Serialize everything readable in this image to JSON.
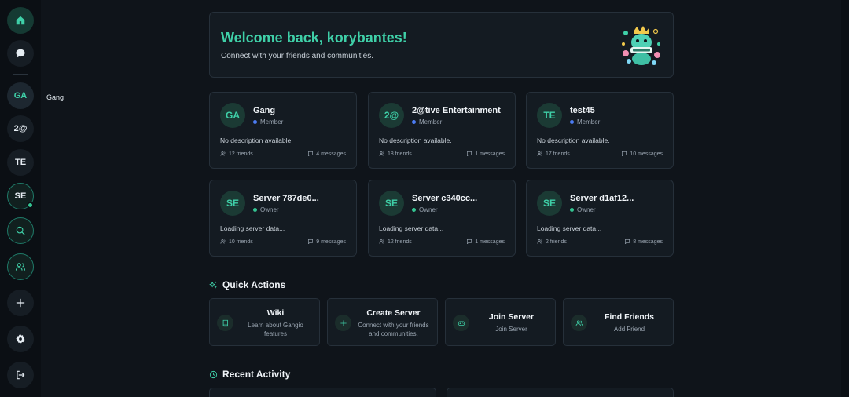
{
  "sidebar": {
    "servers": [
      {
        "initials": "GA",
        "tooltip": "Gang"
      },
      {
        "initials": "2@"
      },
      {
        "initials": "TE"
      },
      {
        "initials": "SE"
      }
    ],
    "tooltip": "Gang"
  },
  "welcome": {
    "title": "Welcome back, korybantes!",
    "subtitle": "Connect with your friends and communities."
  },
  "servers": [
    {
      "initials": "GA",
      "name": "Gang",
      "role": "Member",
      "role_color": "#4c7cf3",
      "description": "No description available.",
      "friends": "12 friends",
      "messages": "4 messages"
    },
    {
      "initials": "2@",
      "name": "2@tive Entertainment",
      "role": "Member",
      "role_color": "#4c7cf3",
      "description": "No description available.",
      "friends": "18 friends",
      "messages": "1 messages"
    },
    {
      "initials": "TE",
      "name": "test45",
      "role": "Member",
      "role_color": "#4c7cf3",
      "description": "No description available.",
      "friends": "17 friends",
      "messages": "10 messages"
    },
    {
      "initials": "SE",
      "name": "Server 787de0...",
      "role": "Owner",
      "role_color": "#34c391",
      "description": "Loading server data...",
      "friends": "10 friends",
      "messages": "9 messages"
    },
    {
      "initials": "SE",
      "name": "Server c340cc...",
      "role": "Owner",
      "role_color": "#34c391",
      "description": "Loading server data...",
      "friends": "12 friends",
      "messages": "1 messages"
    },
    {
      "initials": "SE",
      "name": "Server d1af12...",
      "role": "Owner",
      "role_color": "#34c391",
      "description": "Loading server data...",
      "friends": "2 friends",
      "messages": "8 messages"
    }
  ],
  "quick_actions": {
    "title": "Quick Actions",
    "items": [
      {
        "title": "Wiki",
        "subtitle": "Learn about Gangio features",
        "icon": "book-icon"
      },
      {
        "title": "Create Server",
        "subtitle": "Connect with your friends and communities.",
        "icon": "plus-icon"
      },
      {
        "title": "Join Server",
        "subtitle": "Join Server",
        "icon": "gamepad-icon"
      },
      {
        "title": "Find Friends",
        "subtitle": "Add Friend",
        "icon": "users-icon"
      }
    ]
  },
  "recent_activity": {
    "title": "Recent Activity"
  },
  "colors": {
    "accent": "#3fd0a8",
    "member": "#4c7cf3",
    "owner": "#34c391",
    "background": "#0f141a",
    "card": "#141b22"
  }
}
